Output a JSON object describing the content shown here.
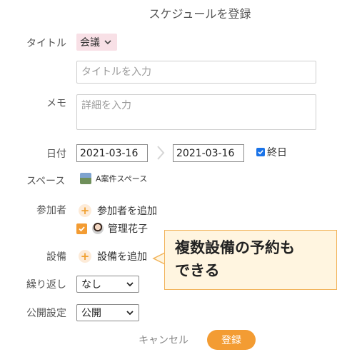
{
  "header": {
    "title": "スケジュールを登録"
  },
  "fields": {
    "title_label": "タイトル",
    "category_value": "会議",
    "title_placeholder": "タイトルを入力",
    "memo_label": "メモ",
    "memo_placeholder": "詳細を入力",
    "date_label": "日付",
    "start_date": "2021-03-16",
    "end_date": "2021-03-16",
    "allday_label": "終日",
    "allday_checked": true,
    "space_label": "スペース",
    "space_value": "A案件スペース",
    "participants_label": "参加者",
    "add_participant": "参加者を追加",
    "participant_name": "管理花子",
    "equipment_label": "設備",
    "add_equipment": "設備を追加",
    "repeat_label": "繰り返し",
    "repeat_value": "なし",
    "visibility_label": "公開設定",
    "visibility_value": "公開"
  },
  "callout": {
    "line1": "複数設備の予約も",
    "line2": "できる"
  },
  "actions": {
    "cancel": "キャンセル",
    "submit": "登録"
  },
  "colors": {
    "accent": "#f39c33",
    "category_bg": "#f8e0e6",
    "check_blue": "#1a73e8",
    "callout_bg": "#fff5e0",
    "callout_border": "#f2b35a"
  },
  "icons": {
    "category": "chevron-down-icon",
    "date_separator": "chevron-right-icon",
    "add": "plus-icon",
    "space": "space-thumbnail-icon",
    "participant": "avatar"
  }
}
